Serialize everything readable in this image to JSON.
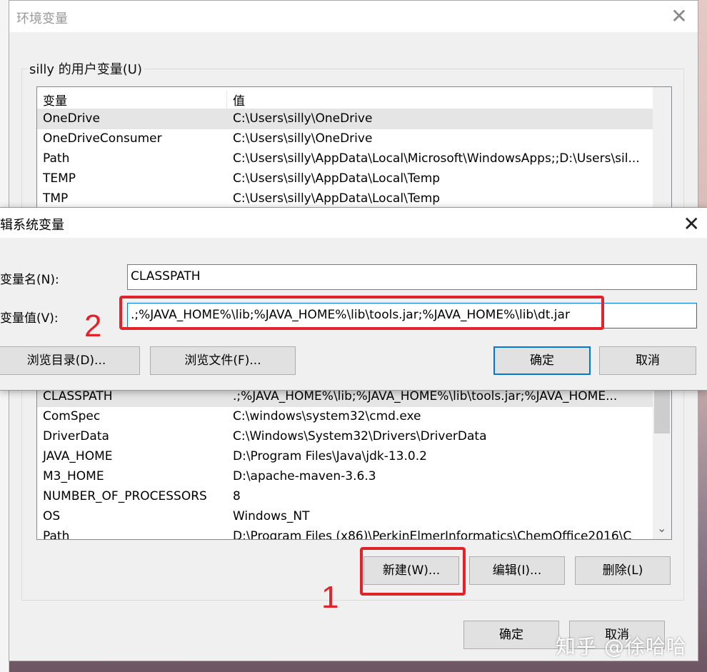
{
  "env_window": {
    "title": "环境变量",
    "user_group_label": "silly 的用户变量(U)",
    "columns": [
      "变量",
      "值"
    ],
    "user_vars": [
      {
        "name": "OneDrive",
        "value": "C:\\Users\\silly\\OneDrive"
      },
      {
        "name": "OneDriveConsumer",
        "value": "C:\\Users\\silly\\OneDrive"
      },
      {
        "name": "Path",
        "value": "C:\\Users\\silly\\AppData\\Local\\Microsoft\\WindowsApps;;D:\\Users\\sil..."
      },
      {
        "name": "TEMP",
        "value": "C:\\Users\\silly\\AppData\\Local\\Temp"
      },
      {
        "name": "TMP",
        "value": "C:\\Users\\silly\\AppData\\Local\\Temp"
      }
    ],
    "system_vars": [
      {
        "name": "CLASSPATH",
        "value": ".;%JAVA_HOME%\\lib;%JAVA_HOME%\\lib\\tools.jar;%JAVA_HOME..."
      },
      {
        "name": "ComSpec",
        "value": "C:\\windows\\system32\\cmd.exe"
      },
      {
        "name": "DriverData",
        "value": "C:\\Windows\\System32\\Drivers\\DriverData"
      },
      {
        "name": "JAVA_HOME",
        "value": "D:\\Program Files\\Java\\jdk-13.0.2"
      },
      {
        "name": "M3_HOME",
        "value": "D:\\apache-maven-3.6.3"
      },
      {
        "name": "NUMBER_OF_PROCESSORS",
        "value": "8"
      },
      {
        "name": "OS",
        "value": "Windows_NT"
      },
      {
        "name": "Path",
        "value": "D:\\Program Files (x86)\\PerkinElmerInformatics\\ChemOffice2016\\C"
      }
    ],
    "new_button": "新建(W)...",
    "edit_button": "编辑(I)...",
    "delete_button": "删除(L)",
    "ok_button": "确定",
    "cancel_button": "取消"
  },
  "edit_dialog": {
    "title": "辑系统变量",
    "name_label": "变量名(N):",
    "value_label": "变量值(V):",
    "name_value": "CLASSPATH",
    "value_value": ".;%JAVA_HOME%\\lib;%JAVA_HOME%\\lib\\tools.jar;%JAVA_HOME%\\lib\\dt.jar",
    "browse_dir_button": "浏览目录(D)...",
    "browse_file_button": "浏览文件(F)...",
    "ok_button": "确定",
    "cancel_button": "取消"
  },
  "annotations": {
    "step1": "1",
    "step2": "2",
    "color": "#e0242a"
  },
  "watermark": "知乎 @徐哈哈"
}
